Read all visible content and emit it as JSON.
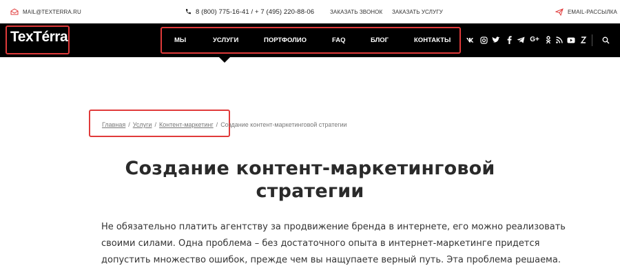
{
  "topbar": {
    "email": "MAIL@TEXTERRA.RU",
    "phones": "8 (800) 775-16-41  /  + 7 (495) 220-88-06",
    "callback": "ЗАКАЗАТЬ ЗВОНОК",
    "order_service": "ЗАКАЗАТЬ УСЛУГУ",
    "newsletter": "EMAIL-РАССЫЛКА"
  },
  "brand": {
    "logo": "TexTérra"
  },
  "nav": {
    "items": [
      "МЫ",
      "УСЛУГИ",
      "ПОРТФОЛИО",
      "FAQ",
      "БЛОГ",
      "КОНТАКТЫ"
    ]
  },
  "social": [
    "vk",
    "instagram",
    "twitter",
    "facebook",
    "telegram",
    "google-plus",
    "odnoklassniki",
    "rss",
    "youtube",
    "zen"
  ],
  "breadcrumb": {
    "items": [
      "Главная",
      "Услуги",
      "Контент-маркетинг"
    ],
    "current": "Создание контент-маркетинговой стратегии"
  },
  "page": {
    "title_line1": "Создание контент-маркетинговой",
    "title_line2": "стратегии",
    "intro_line1": "Не обязательно платить агентству за продвижение бренда в интернете, его можно реализовать",
    "intro_line2": "своими силами. Одна проблема – без достаточного опыта в интернет-маркетинге придется",
    "intro_line3": "допустить множество ошибок, прежде чем вы нащупаете верный путь. Эта проблема решаема."
  },
  "colors": {
    "accent_red": "#e03a3a",
    "nav_bg": "#000000"
  }
}
